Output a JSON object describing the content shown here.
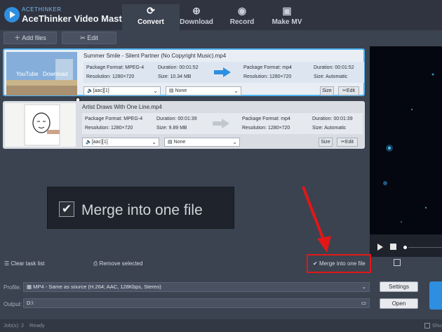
{
  "app": {
    "brand_small": "ACETHINKER",
    "title": "AceThinker Video Master"
  },
  "tabs": [
    {
      "label": "Convert",
      "icon": "refresh-icon",
      "glyph": "⟳"
    },
    {
      "label": "Download",
      "icon": "download-icon",
      "glyph": "⊕"
    },
    {
      "label": "Record",
      "icon": "record-icon",
      "glyph": "◉"
    },
    {
      "label": "Make MV",
      "icon": "tv-icon",
      "glyph": "▣"
    }
  ],
  "toolbar": {
    "add_files": "Add files",
    "edit": "Edit"
  },
  "tasks": [
    {
      "name": "Summer Smile - Silent Partner (No Copyright Music).mp4",
      "src_format": "Package Format: MPEG-4",
      "src_duration": "Duration: 00:01:52",
      "src_resolution": "Resolution: 1280×720",
      "src_size": "Size: 10.34 MB",
      "out_format": "Package Format: mp4",
      "out_duration": "Duration: 00:01:52",
      "out_resolution": "Resolution: 1280×720",
      "out_size": "Size: Automatic",
      "audio": "[aac][1]",
      "subtitle": "None",
      "size_btn": "Size",
      "edit_btn": "Edit",
      "thumb_text_1": "YouTube",
      "thumb_text_2": "Download"
    },
    {
      "name": "Artist Draws With One Line.mp4",
      "src_format": "Package Format: MPEG-4",
      "src_duration": "Duration: 00:01:39",
      "src_resolution": "Resolution: 1280×720",
      "src_size": "Size: 9.89 MB",
      "out_format": "Package Format: mp4",
      "out_duration": "Duration: 00:01:39",
      "out_resolution": "Resolution: 1280×720",
      "out_size": "Size: Automatic",
      "audio": "[aac][1]",
      "subtitle": "None",
      "size_btn": "Size",
      "edit_btn": "Edit"
    }
  ],
  "zoom_label": "Merge into one file",
  "bottom": {
    "clear": "Clear task list",
    "remove": "Remove selected",
    "merge": "Merge into one file",
    "merge_checked": true
  },
  "profile": {
    "label": "Profile:",
    "value": "MP4 - Same as source (H.264; AAC, 128Kbps, Stereo)",
    "settings_btn": "Settings"
  },
  "output": {
    "label": "Output:",
    "value": "D:\\",
    "open_btn": "Open"
  },
  "status": {
    "jobs": "Job(s): 2",
    "state": "Ready",
    "shutdown": "Shut"
  },
  "colors": {
    "accent": "#2e8fe0",
    "highlight": "#e01818",
    "selection": "#4fb3f0"
  }
}
